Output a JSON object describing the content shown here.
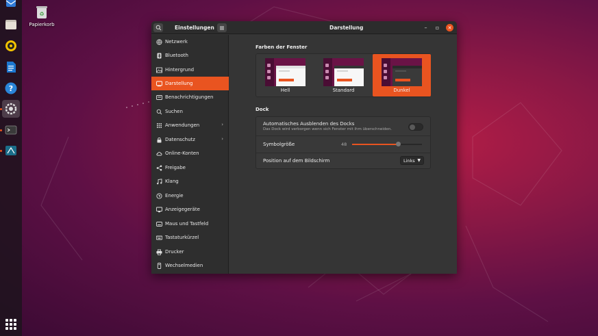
{
  "desktop": {
    "trash_label": "Papierkorb",
    "dock_apps": [
      {
        "name": "thunderbird-icon"
      },
      {
        "name": "files-icon"
      },
      {
        "name": "rhythmbox-icon"
      },
      {
        "name": "libreoffice-writer-icon"
      },
      {
        "name": "help-icon"
      },
      {
        "name": "settings-icon"
      },
      {
        "name": "terminal-icon"
      },
      {
        "name": "network-icon"
      }
    ]
  },
  "window": {
    "sidebar_title": "Einstellungen",
    "title": "Darstellung",
    "controls": {
      "minimize": "–",
      "maximize": "▫",
      "close": "✕"
    }
  },
  "sidebar": {
    "items": [
      {
        "label": "Netzwerk",
        "icon": "network-icon"
      },
      {
        "label": "Bluetooth",
        "icon": "bluetooth-icon"
      },
      {
        "label": "Hintergrund",
        "icon": "background-icon"
      },
      {
        "label": "Darstellung",
        "icon": "appearance-icon",
        "selected": true
      },
      {
        "label": "Benachrichtigungen",
        "icon": "notifications-icon"
      },
      {
        "label": "Suchen",
        "icon": "search-icon"
      },
      {
        "label": "Anwendungen",
        "icon": "apps-icon",
        "chevron": true
      },
      {
        "label": "Datenschutz",
        "icon": "privacy-icon",
        "chevron": true
      },
      {
        "label": "Online-Konten",
        "icon": "cloud-icon"
      },
      {
        "label": "Freigabe",
        "icon": "share-icon"
      },
      {
        "label": "Klang",
        "icon": "music-icon"
      },
      {
        "label": "Energie",
        "icon": "power-icon"
      },
      {
        "label": "Anzeigegeräte",
        "icon": "display-icon"
      },
      {
        "label": "Maus und Tastfeld",
        "icon": "mouse-icon"
      },
      {
        "label": "Tastaturkürzel",
        "icon": "keyboard-icon"
      },
      {
        "label": "Drucker",
        "icon": "printer-icon"
      },
      {
        "label": "Wechselmedien",
        "icon": "removable-media-icon"
      }
    ]
  },
  "appearance": {
    "window_colors_title": "Farben der Fenster",
    "themes": [
      {
        "label": "Hell",
        "selected": false
      },
      {
        "label": "Standard",
        "selected": false
      },
      {
        "label": "Dunkel",
        "selected": true
      }
    ],
    "dock_title": "Dock",
    "autohide": {
      "title": "Automatisches Ausblenden des Docks",
      "subtitle": "Das Dock wird verborgen wenn sich Fenster mit ihm überschneiden.",
      "enabled": false
    },
    "icon_size": {
      "label": "Symbolgröße",
      "value": "48",
      "fraction": 0.66
    },
    "position": {
      "label": "Position auf dem Bildschirm",
      "value": "Links"
    }
  },
  "colors": {
    "accent": "#e95420",
    "window_bg": "#353535",
    "sidebar_bg": "#2e2e2e"
  }
}
